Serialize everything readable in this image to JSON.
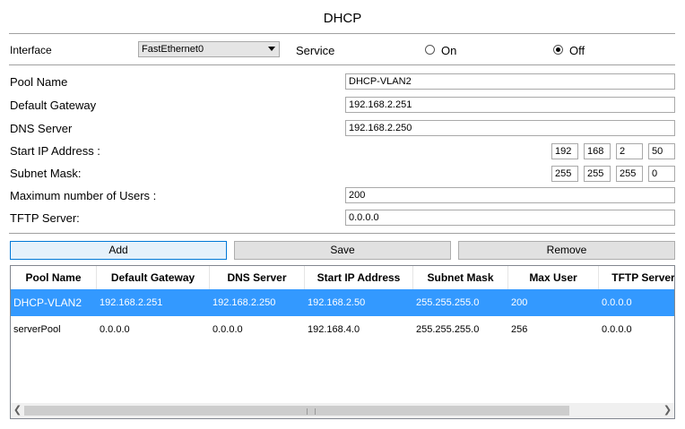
{
  "title": "DHCP",
  "interface": {
    "label": "Interface",
    "selected": "FastEthernet0"
  },
  "service": {
    "label": "Service",
    "on_label": "On",
    "off_label": "Off",
    "selected": "Off"
  },
  "fields": {
    "pool_name_label": "Pool Name",
    "pool_name_value": "DHCP-VLAN2",
    "gateway_label": "Default Gateway",
    "gateway_value": "192.168.2.251",
    "dns_label": "DNS Server",
    "dns_value": "192.168.2.250",
    "start_ip_label": "Start IP Address :",
    "start_ip": [
      "192",
      "168",
      "2",
      "50"
    ],
    "subnet_label": "Subnet Mask:",
    "subnet": [
      "255",
      "255",
      "255",
      "0"
    ],
    "max_users_label": "Maximum number of Users :",
    "max_users_value": "200",
    "tftp_label": "TFTP Server:",
    "tftp_value": "0.0.0.0"
  },
  "buttons": {
    "add": "Add",
    "save": "Save",
    "remove": "Remove"
  },
  "table": {
    "columns": [
      "Pool Name",
      "Default Gateway",
      "DNS Server",
      "Start IP Address",
      "Subnet Mask",
      "Max User",
      "TFTP Server"
    ],
    "rows": [
      [
        "DHCP-VLAN2",
        "192.168.2.251",
        "192.168.2.250",
        "192.168.2.50",
        "255.255.255.0",
        "200",
        "0.0.0.0"
      ],
      [
        "serverPool",
        "0.0.0.0",
        "0.0.0.0",
        "192.168.4.0",
        "255.255.255.0",
        "256",
        "0.0.0.0"
      ]
    ],
    "selected_row": 0
  },
  "colors": {
    "selection": "#3399ff",
    "button_focus_border": "#0078d7"
  }
}
